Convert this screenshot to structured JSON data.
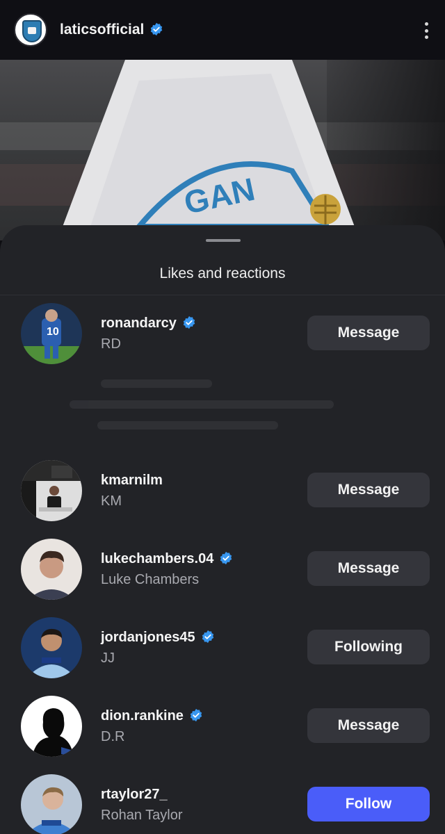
{
  "header": {
    "account_name": "laticsofficial",
    "verified": true,
    "logo_icon": "wigan-athletic-crest-icon",
    "more_icon": "more-vertical-icon"
  },
  "sheet": {
    "title": "Likes and reactions"
  },
  "users": [
    {
      "username": "ronandarcy",
      "fullname": "RD",
      "verified": true,
      "button": "Message",
      "avatar_color": "#2b5fb0"
    },
    {
      "username": "kmarnilm",
      "fullname": "KM",
      "verified": false,
      "button": "Message",
      "avatar_color": "#d9d9d9"
    },
    {
      "username": "lukechambers.04",
      "fullname": "Luke Chambers",
      "verified": true,
      "button": "Message",
      "avatar_color": "#b98a77"
    },
    {
      "username": "jordanjones45",
      "fullname": "JJ",
      "verified": true,
      "button": "Following",
      "avatar_color": "#5fa0d8"
    },
    {
      "username": "dion.rankine",
      "fullname": "D.R",
      "verified": true,
      "button": "Message",
      "avatar_color": "#ffffff"
    },
    {
      "username": "rtaylor27_",
      "fullname": "Rohan Taylor",
      "verified": false,
      "button": "Follow",
      "avatar_color": "#3e7fd0"
    }
  ],
  "colors": {
    "accent": "#4a5df9",
    "verified_badge": "#3897f0",
    "sheet_bg": "#222327"
  }
}
